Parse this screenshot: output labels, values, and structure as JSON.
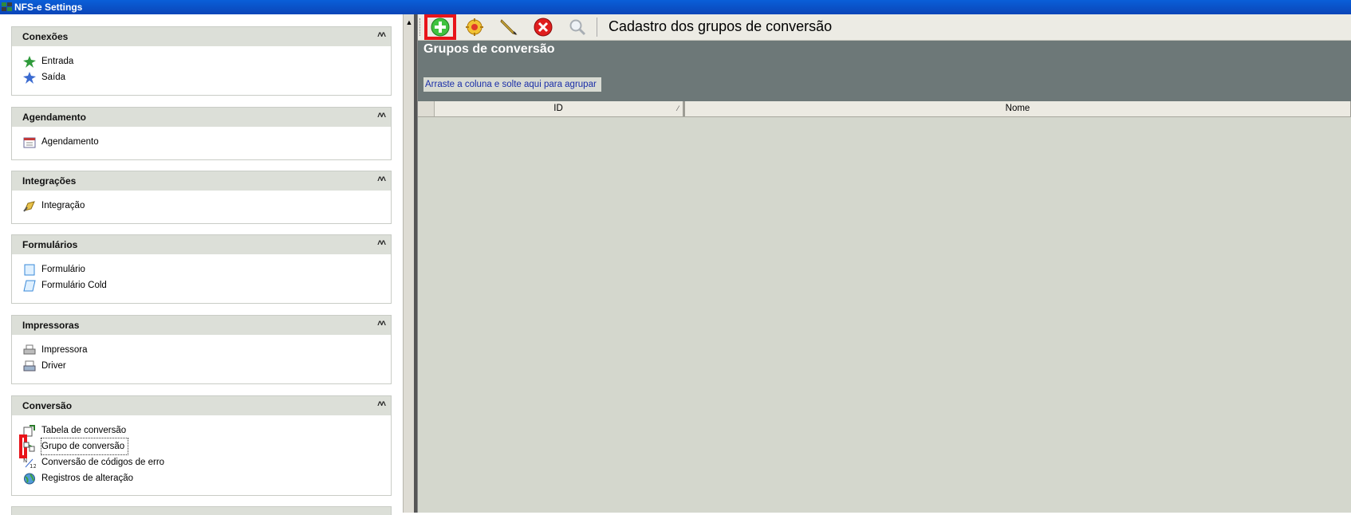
{
  "window": {
    "title": "NFS-e Settings"
  },
  "sidebar": {
    "groups": [
      {
        "title": "Conexões",
        "items": [
          {
            "label": "Entrada",
            "icon": "entrada-icon"
          },
          {
            "label": "Saída",
            "icon": "saida-icon"
          }
        ]
      },
      {
        "title": "Agendamento",
        "items": [
          {
            "label": "Agendamento",
            "icon": "calendar-icon"
          }
        ]
      },
      {
        "title": "Integrações",
        "items": [
          {
            "label": "Integração",
            "icon": "integration-icon"
          }
        ]
      },
      {
        "title": "Formulários",
        "items": [
          {
            "label": "Formulário",
            "icon": "form-icon"
          },
          {
            "label": "Formulário Cold",
            "icon": "form-cold-icon"
          }
        ]
      },
      {
        "title": "Impressoras",
        "items": [
          {
            "label": "Impressora",
            "icon": "printer-icon"
          },
          {
            "label": "Driver",
            "icon": "driver-icon"
          }
        ]
      },
      {
        "title": "Conversão",
        "items": [
          {
            "label": "Tabela de conversão",
            "icon": "conversion-table-icon"
          },
          {
            "label": "Grupo de conversão",
            "icon": "conversion-group-icon",
            "selected": true
          },
          {
            "label": "Conversão de códigos de erro",
            "icon": "error-code-icon"
          },
          {
            "label": "Registros de alteração",
            "icon": "globe-icon"
          }
        ]
      }
    ],
    "collapse_glyph": "˄˄"
  },
  "toolbar": {
    "buttons": [
      {
        "name": "add",
        "icon": "add-icon",
        "highlighted": true
      },
      {
        "name": "options",
        "icon": "options-icon"
      },
      {
        "name": "edit",
        "icon": "pencil-icon"
      },
      {
        "name": "delete",
        "icon": "delete-icon"
      },
      {
        "name": "search",
        "icon": "search-icon"
      }
    ],
    "title": "Cadastro dos grupos de conversão"
  },
  "panel": {
    "title": "Grupos de conversão",
    "group_hint": "Arraste a coluna e solte aqui para agrupar"
  },
  "grid": {
    "columns": [
      {
        "label": "ID",
        "sorted": true
      },
      {
        "label": "Nome"
      }
    ],
    "sort_glyph": "⁄"
  },
  "colors": {
    "highlight": "#e8141a",
    "titlebar": "#0a5fd8",
    "panel_header": "#6d7878",
    "workspace": "#d4d7cd"
  }
}
